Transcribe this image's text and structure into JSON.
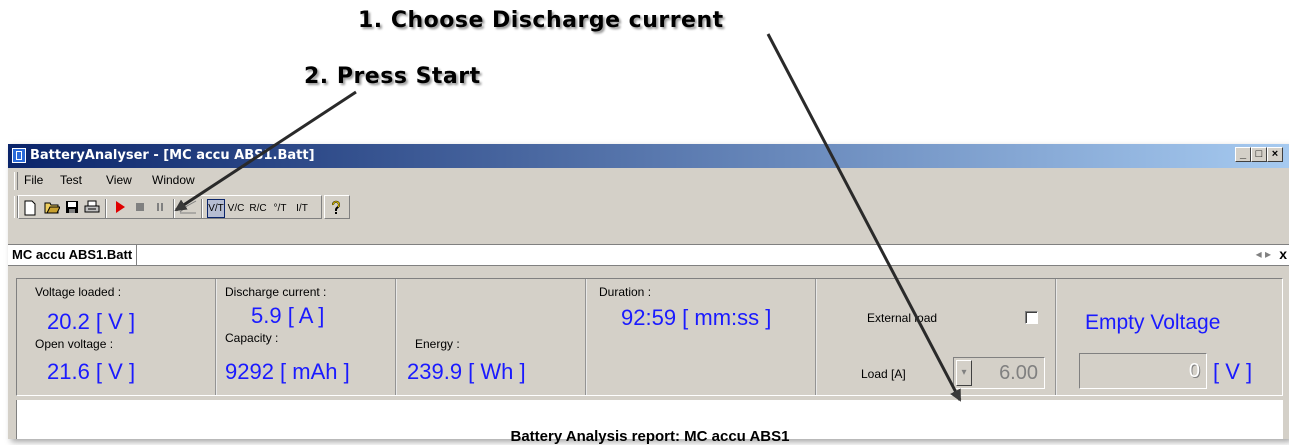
{
  "annotations": {
    "step1": "1. Choose Discharge current",
    "step2": "2. Press Start"
  },
  "window": {
    "title": "BatteryAnalyser - [MC accu ABS1.Batt]",
    "controls": [
      "_",
      "□",
      "x"
    ]
  },
  "menu": [
    {
      "label": "File"
    },
    {
      "label": "Test"
    },
    {
      "label": "View"
    },
    {
      "label": "Window"
    }
  ],
  "toolbar": {
    "icons": [
      "new-icon",
      "open-icon",
      "save-icon",
      "print-icon",
      "start-icon",
      "stop-icon",
      "pause-icon",
      "curve-icon",
      "view-vt-icon",
      "view-vc-icon",
      "view-rc-icon",
      "view-temp-icon",
      "view-it-icon",
      "help-icon"
    ],
    "view_labels": {
      "vt": "V/T",
      "vc": "V/C",
      "rc": "R/C",
      "tt": "°/T",
      "it": "I/T"
    }
  },
  "document": {
    "tab": "MC accu ABS1.Batt",
    "close": "x"
  },
  "panel": {
    "voltage_loaded_label": "Voltage loaded :",
    "voltage_loaded_value": "20.2  [ V ]",
    "open_voltage_label": "Open voltage :",
    "open_voltage_value": "21.6  [ V ]",
    "discharge_current_label": "Discharge current :",
    "discharge_current_value": "5.9  [ A ]",
    "capacity_label": "Capacity :",
    "capacity_value": "9292  [ mAh ]",
    "energy_label": "Energy :",
    "energy_value": "239.9  [ Wh ]",
    "duration_label": "Duration :",
    "duration_value": "92:59  [ mm:ss ]",
    "external_load_label": "External load",
    "load_label": "Load  [A]",
    "load_value": "6.00",
    "empty_voltage_label": "Empty Voltage",
    "empty_voltage_value": "0",
    "empty_voltage_unit": "[ V ]"
  },
  "report": {
    "title": "Battery Analysis report: MC accu ABS1"
  },
  "colors": {
    "value_blue": "#1a1aff",
    "titlebar_start": "#0a246a",
    "titlebar_end": "#a6caf0",
    "start_red": "#e00000"
  }
}
